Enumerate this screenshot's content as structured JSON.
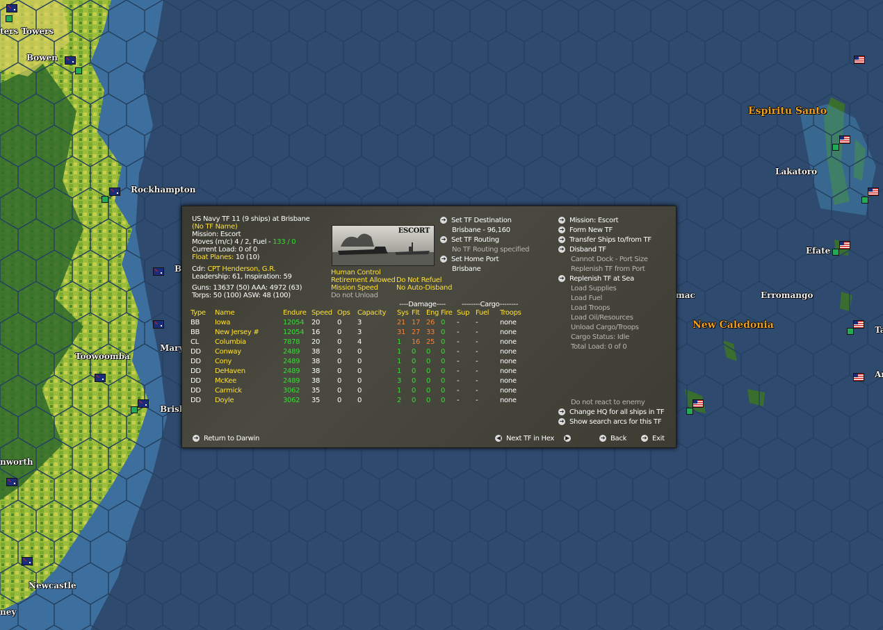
{
  "map": {
    "labels": [
      {
        "text": "ters Towers",
        "cls": "maplabel"
      },
      {
        "text": "Bowen",
        "cls": "maplabel"
      },
      {
        "text": "Rockhampton",
        "cls": "maplabel"
      },
      {
        "text": "B",
        "cls": "maplabel"
      },
      {
        "text": "Mary",
        "cls": "maplabel"
      },
      {
        "text": "Toowoomba",
        "cls": "maplabel"
      },
      {
        "text": "Brisb",
        "cls": "maplabel"
      },
      {
        "text": "nworth",
        "cls": "maplabel"
      },
      {
        "text": "Newcastle",
        "cls": "maplabel"
      },
      {
        "text": "ney",
        "cls": "maplabel"
      },
      {
        "text": "Espiritu Santo",
        "cls": "maplabel gold"
      },
      {
        "text": "Lakatoro",
        "cls": "maplabel"
      },
      {
        "text": "Efate",
        "cls": "maplabel"
      },
      {
        "text": "Erromango",
        "cls": "maplabel"
      },
      {
        "text": "New Caledonia",
        "cls": "maplabel gold"
      },
      {
        "text": "mac",
        "cls": "maplabel"
      },
      {
        "text": "Ta",
        "cls": "maplabel"
      },
      {
        "text": "Ar",
        "cls": "maplabel"
      }
    ]
  },
  "tf": {
    "header": "US Navy TF 11 (9 ships) at Brisbane",
    "name": "(No TF Name)",
    "mission": "Mission:  Escort",
    "moves_prefix": "Moves (m/c)  4 / 2, Fuel - ",
    "moves_fuel": "133 / 0",
    "current_load": "Current Load: 0 of 0",
    "float_label": "Float Planes: ",
    "float_value": "10 (10)",
    "cdr_label": "Cdr:  ",
    "cdr_name": "CPT  Henderson, G.R.",
    "leadership": "Leadership: 61, Inspiration: 59",
    "guns": "Guns: 13637 (50)   AAA: 4972 (63)",
    "torps": "Torps: 50 (100)       ASW: 48 (100)",
    "image_label": "ESCORT",
    "flags": [
      "Human Control",
      "Retirement Allowed",
      "Do Not Refuel",
      "Mission Speed",
      "No Auto-Disband",
      "Do not Unload"
    ]
  },
  "mid": {
    "set_dest": "Set TF Destination",
    "dest_value": "Brisbane - 96,160",
    "set_routing": "Set TF Routing",
    "routing_value": "No TF Routing specified",
    "set_home": "Set Home Port",
    "home_value": "Brisbane"
  },
  "right": {
    "mission": "Mission: Escort",
    "form_new": "Form New TF",
    "transfer": "Transfer Ships to/from TF",
    "disband": "Disband TF",
    "cannot_dock": "Cannot Dock - Port Size",
    "replenish_port": "Replenish TF from Port",
    "replenish_sea": "Replenish TF at Sea",
    "load_supplies": "Load Supplies",
    "load_fuel": "Load Fuel",
    "load_troops": "Load Troops",
    "load_oil": "Load Oil/Resources",
    "unload": "Unload Cargo/Troops",
    "cargo_status": "Cargo Status: Idle",
    "total_load": "Total Load: 0 of 0",
    "no_react": "Do not react to enemy",
    "change_hq": "Change HQ for all ships in TF",
    "show_arcs": "Show search arcs for this TF"
  },
  "table": {
    "group_damage": "----Damage----",
    "group_cargo": "--------Cargo--------",
    "headers": [
      "Type",
      "Name",
      "Endure",
      "Speed",
      "Ops",
      "Capacity",
      "Sys",
      "Flt",
      "Eng",
      "Fire",
      "Sup",
      "Fuel",
      "Troops"
    ],
    "rows": [
      [
        "BB",
        "Iowa",
        "12054",
        "20",
        "0",
        "3",
        "21",
        "17",
        "26",
        "0",
        "-",
        "-",
        "none"
      ],
      [
        "BB",
        "New Jersey #",
        "12054",
        "16",
        "0",
        "3",
        "31",
        "27",
        "33",
        "0",
        "-",
        "-",
        "none"
      ],
      [
        "CL",
        "Columbia",
        "7878",
        "20",
        "0",
        "4",
        "1",
        "16",
        "25",
        "0",
        "-",
        "-",
        "none"
      ],
      [
        "DD",
        "Conway",
        "2489",
        "38",
        "0",
        "0",
        "1",
        "0",
        "0",
        "0",
        "-",
        "-",
        "none"
      ],
      [
        "DD",
        "Cony",
        "2489",
        "38",
        "0",
        "0",
        "1",
        "0",
        "0",
        "0",
        "-",
        "-",
        "none"
      ],
      [
        "DD",
        "DeHaven",
        "2489",
        "38",
        "0",
        "0",
        "1",
        "0",
        "0",
        "0",
        "-",
        "-",
        "none"
      ],
      [
        "DD",
        "McKee",
        "2489",
        "38",
        "0",
        "0",
        "3",
        "0",
        "0",
        "0",
        "-",
        "-",
        "none"
      ],
      [
        "DD",
        "Carmick",
        "3062",
        "35",
        "0",
        "0",
        "1",
        "0",
        "0",
        "0",
        "-",
        "-",
        "none"
      ],
      [
        "DD",
        "Doyle",
        "3062",
        "35",
        "0",
        "0",
        "2",
        "0",
        "0",
        "0",
        "-",
        "-",
        "none"
      ]
    ]
  },
  "bottom": {
    "return": "Return to Darwin",
    "next": "Next TF in Hex",
    "back": "Back",
    "exit": "Exit"
  },
  "colors": {
    "sea": "#2e4a6e",
    "panel": "#42423a",
    "white": "#ffffff",
    "yellow": "#ffe030",
    "green": "#30e030",
    "orange": "#ff8030",
    "gray": "#b8b8b0"
  }
}
